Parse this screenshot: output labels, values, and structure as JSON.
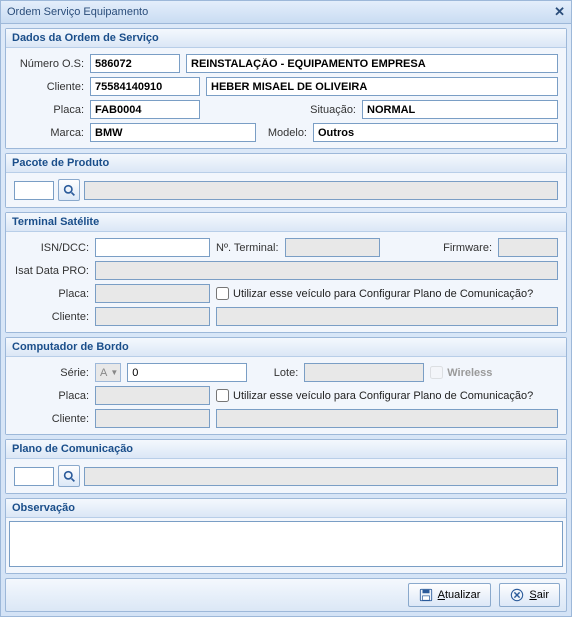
{
  "window": {
    "title": "Ordem Serviço Equipamento"
  },
  "dados": {
    "header": "Dados da Ordem de Serviço",
    "numero_os_label": "Número O.S:",
    "numero_os": "586072",
    "descricao": "REINSTALAÇÃO - EQUIPAMENTO EMPRESA",
    "cliente_label": "Cliente:",
    "cliente_cod": "75584140910",
    "cliente_nome": "HEBER MISAEL DE OLIVEIRA",
    "placa_label": "Placa:",
    "placa": "FAB0004",
    "situacao_label": "Situação:",
    "situacao": "NORMAL",
    "marca_label": "Marca:",
    "marca": "BMW",
    "modelo_label": "Modelo:",
    "modelo": "Outros"
  },
  "pacote": {
    "header": "Pacote de Produto",
    "cod": "",
    "desc": ""
  },
  "terminal": {
    "header": "Terminal Satélite",
    "isn_label": "ISN/DCC:",
    "isn": "",
    "num_terminal_label": "Nº. Terminal:",
    "num_terminal": "",
    "firmware_label": "Firmware:",
    "firmware": "",
    "isat_label": "Isat Data PRO:",
    "isat": "",
    "placa_label": "Placa:",
    "placa": "",
    "config_label": "Utilizar esse veículo para Configurar Plano de Comunicação?",
    "cliente_label": "Cliente:",
    "cliente_cod": "",
    "cliente_nome": ""
  },
  "computador": {
    "header": "Computador de Bordo",
    "serie_label": "Série:",
    "serie_prefix": "A",
    "serie_num": "0",
    "lote_label": "Lote:",
    "lote": "",
    "wireless_label": "Wireless",
    "placa_label": "Placa:",
    "placa": "",
    "config_label": "Utilizar esse veículo para Configurar Plano de Comunicação?",
    "cliente_label": "Cliente:",
    "cliente_cod": "",
    "cliente_nome": ""
  },
  "plano": {
    "header": "Plano de Comunicação",
    "cod": "",
    "desc": ""
  },
  "observacao": {
    "header": "Observação",
    "text": ""
  },
  "footer": {
    "atualizar": "Atualizar",
    "sair": "Sair"
  }
}
